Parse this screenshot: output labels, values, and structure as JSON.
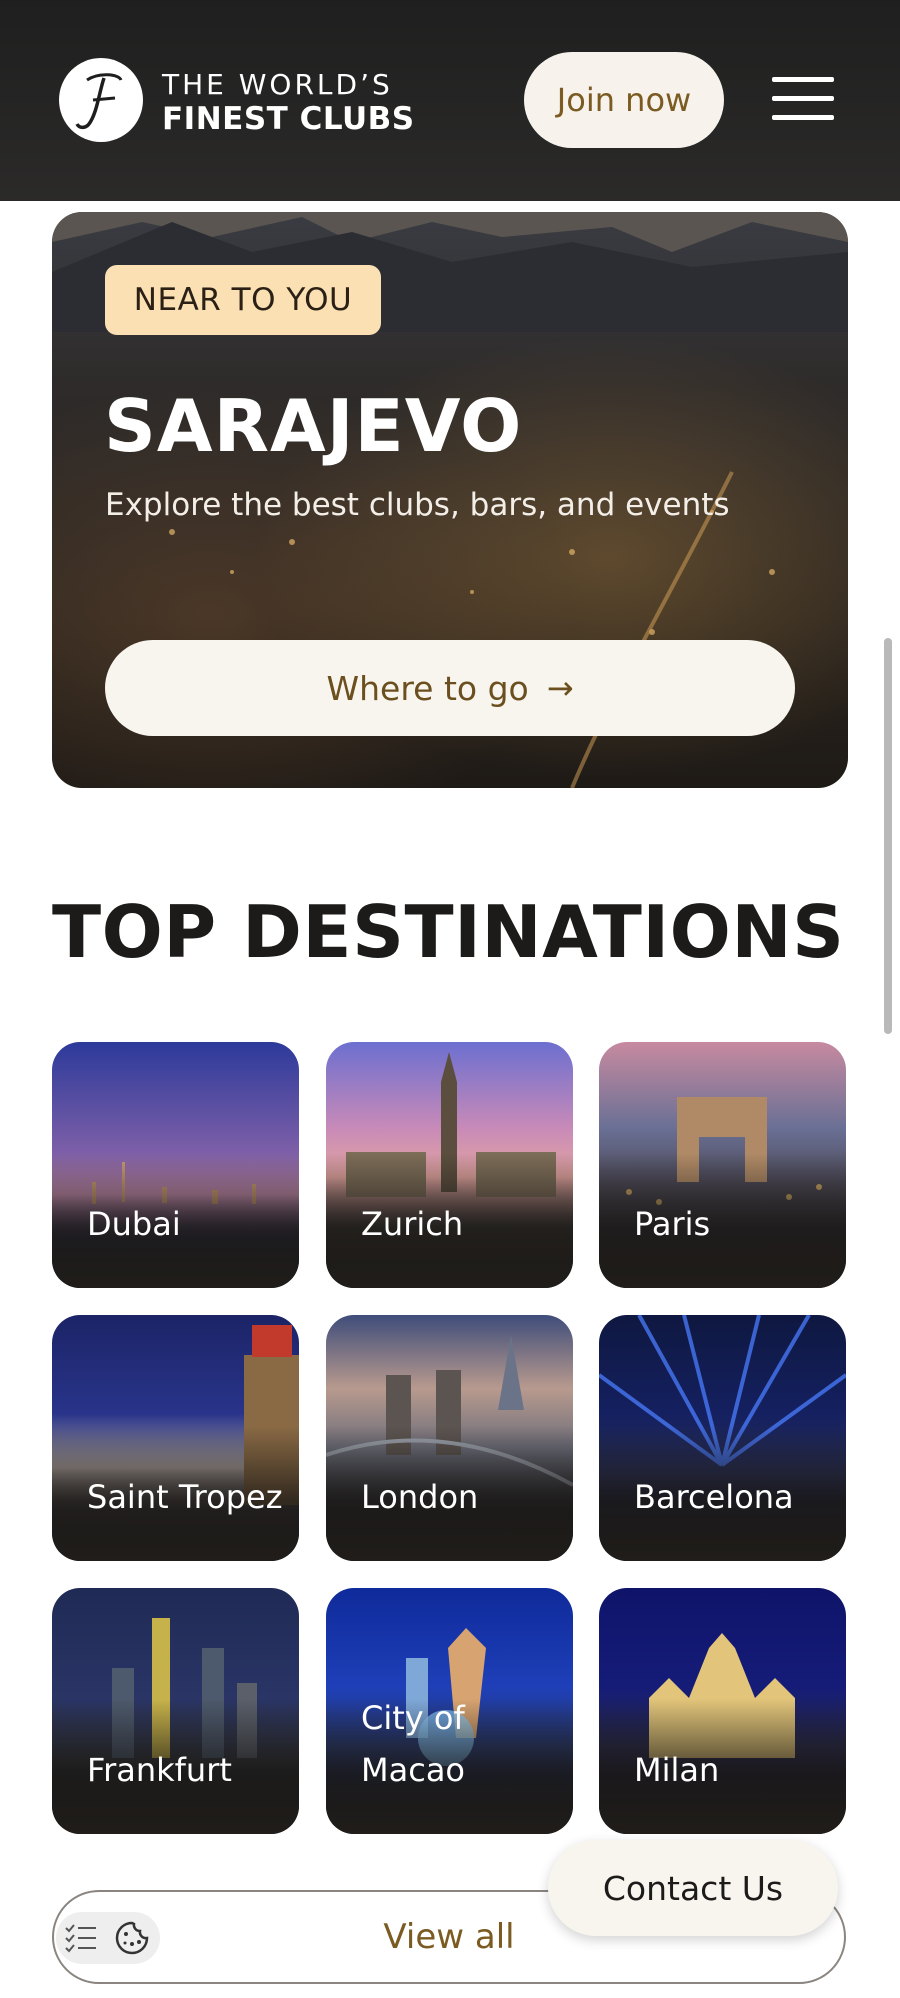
{
  "header": {
    "logo_line1": "THE WORLD’S",
    "logo_line2": "FINEST CLUBS",
    "join_label": "Join now",
    "menu_icon": "hamburger-icon"
  },
  "hero": {
    "badge": "NEAR TO YOU",
    "title": "SARAJEVO",
    "subtitle": "Explore the best clubs, bars, and events",
    "button_label": "Where to go",
    "button_icon": "→"
  },
  "destinations": {
    "title": "TOP DESTINATIONS",
    "items": [
      {
        "label": "Dubai"
      },
      {
        "label": "Zurich"
      },
      {
        "label": "Paris"
      },
      {
        "label": "Saint Tropez"
      },
      {
        "label": "London"
      },
      {
        "label": "Barcelona"
      },
      {
        "label": "Frankfurt"
      },
      {
        "label": "City of Macao"
      },
      {
        "label": "Milan"
      }
    ],
    "view_all": "View all"
  },
  "contact": {
    "label": "Contact Us"
  },
  "colors": {
    "header_bg": "#2a2928",
    "accent_gold": "#7b5b22",
    "badge_bg": "#fbe0b4"
  }
}
